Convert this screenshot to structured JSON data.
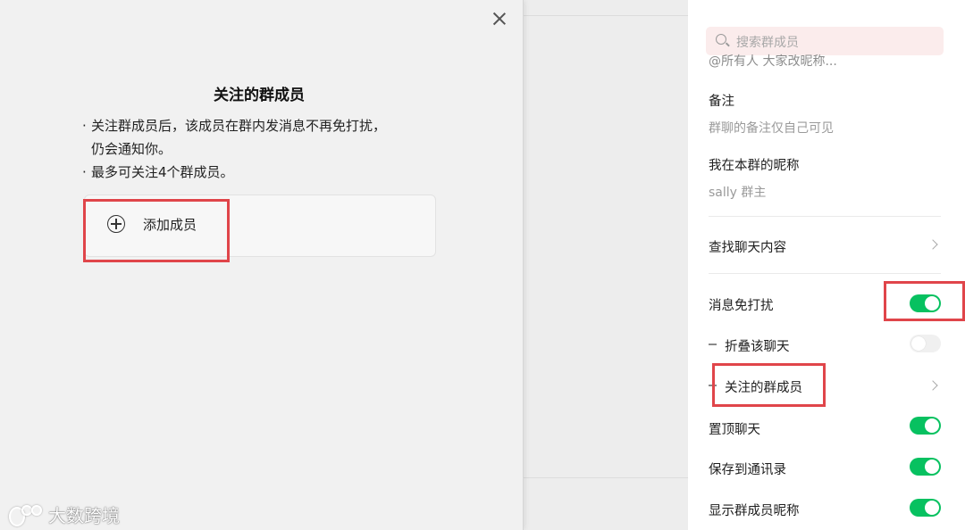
{
  "modal": {
    "title": "关注的群成员",
    "bullets": [
      "关注群成员后，该成员在群内发消息不再免打扰，",
      "仍会通知你。",
      "最多可关注4个群成员。"
    ],
    "bullet_dot": "·",
    "add_member_label": "添加成员"
  },
  "panel": {
    "search_placeholder": "搜索群成员",
    "clipped_text": "@所有人 大家改昵称...",
    "remark_label": "备注",
    "remark_hint": "群聊的备注仅自己可见",
    "nickname_label": "我在本群的昵称",
    "nickname_value": "sally 群主",
    "find_chat_label": "查找聊天内容",
    "mute_label": "消息免打扰",
    "mute_on": true,
    "fold_label": "折叠该聊天",
    "fold_on": false,
    "followed_members_label": "关注的群成员",
    "pin_label": "置顶聊天",
    "pin_on": true,
    "save_contacts_label": "保存到通讯录",
    "save_contacts_on": true,
    "show_nicknames_label": "显示群成员昵称",
    "show_nicknames_on": true
  },
  "watermark": {
    "text": "大数跨境"
  },
  "colors": {
    "toggle_on": "#07c160",
    "highlight": "#e0454a"
  }
}
